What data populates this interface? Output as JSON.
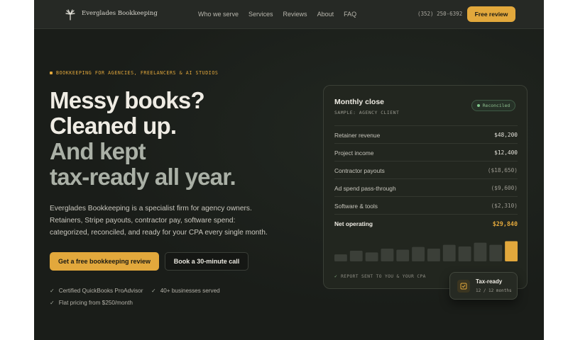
{
  "nav": {
    "brand": "Everglades Bookkeeping",
    "links": [
      "Who we serve",
      "Services",
      "Reviews",
      "About",
      "FAQ"
    ],
    "phone": "(352) 250-6392",
    "cta": "Free review"
  },
  "hero": {
    "eyebrow": "BOOKKEEPING FOR AGENCIES, FREELANCERS & AI STUDIOS",
    "headline": [
      "Messy books?",
      "Cleaned up.",
      "And kept",
      "tax-ready all year."
    ],
    "description": [
      "Everglades Bookkeeping is a specialist firm for agency owners.",
      "Retainers, Stripe payouts, contractor pay, software spend:",
      "categorized, reconciled, and ready for your CPA every single month."
    ],
    "primary_button": "Get a free bookkeeping review",
    "secondary_button": "Book a 30-minute call",
    "trust": [
      "Certified QuickBooks ProAdvisor",
      "40+ businesses served",
      "Flat pricing from $250/month"
    ]
  },
  "card": {
    "title": "Monthly close",
    "subtitle": "SAMPLE: AGENCY CLIENT",
    "badge": "Reconciled",
    "rows": [
      {
        "label": "Retainer revenue",
        "value": "$48,200"
      },
      {
        "label": "Project income",
        "value": "$12,400"
      },
      {
        "label": "Contractor payouts",
        "value": "($18,650)"
      },
      {
        "label": "Ad spend pass-through",
        "value": "($9,600)"
      },
      {
        "label": "Software & tools",
        "value": "($2,310)"
      }
    ],
    "total": {
      "label": "Net operating",
      "value": "$29,840"
    },
    "bars": [
      0.33,
      0.5,
      0.42,
      0.6,
      0.55,
      0.68,
      0.6,
      0.78,
      0.7,
      0.88,
      0.78,
      0.95
    ],
    "bar_color": "#3b3f38",
    "bar_highlight": "#e2a83c",
    "footnote": "REPORT SENT TO YOU & YOUR CPA"
  },
  "float": {
    "title": "Tax-ready",
    "subtitle": "12 / 12 months"
  },
  "colors": {
    "accent": "#e2a83c",
    "background": "#1a1d19",
    "positive": "#8fbf8f"
  }
}
